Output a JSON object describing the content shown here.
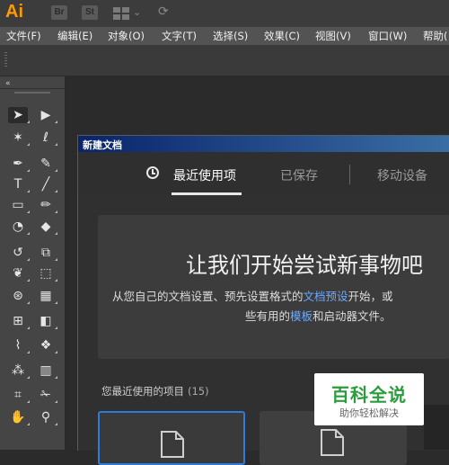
{
  "app": {
    "logo": "Ai",
    "bridge_icon": "Br",
    "stock_icon": "St",
    "workspace_icon": "workspace-grid-icon",
    "sync_icon": "sync-icon",
    "accent": "#ff9a00"
  },
  "menu": {
    "items": [
      {
        "label": "文件(F)"
      },
      {
        "label": "编辑(E)"
      },
      {
        "label": "对象(O)"
      },
      {
        "label": "文字(T)"
      },
      {
        "label": "选择(S)"
      },
      {
        "label": "效果(C)"
      },
      {
        "label": "视图(V)"
      },
      {
        "label": "窗口(W)"
      },
      {
        "label": "帮助("
      }
    ]
  },
  "tools": {
    "collapse_icon": "«"
  },
  "dialog": {
    "title": "新建文档",
    "tabs": [
      {
        "label": "最近使用项",
        "icon": "clock-icon",
        "active": true
      },
      {
        "label": "已保存",
        "active": false
      },
      {
        "label": "移动设备",
        "active": false
      }
    ],
    "hero": {
      "title": "让我们开始尝试新事物吧",
      "line1_before": "从您自己的文档设置、预先设置格式的",
      "line1_link": "文档预设",
      "line1_after": "开始，或",
      "line2_before": "些有用的",
      "line2_link": "模板",
      "line2_after": "和启动器文件。"
    },
    "recent": {
      "label": "您最近使用的项目",
      "count": "(15)"
    }
  },
  "watermark": {
    "main": "百科全说",
    "sub": "助你轻松解决"
  }
}
